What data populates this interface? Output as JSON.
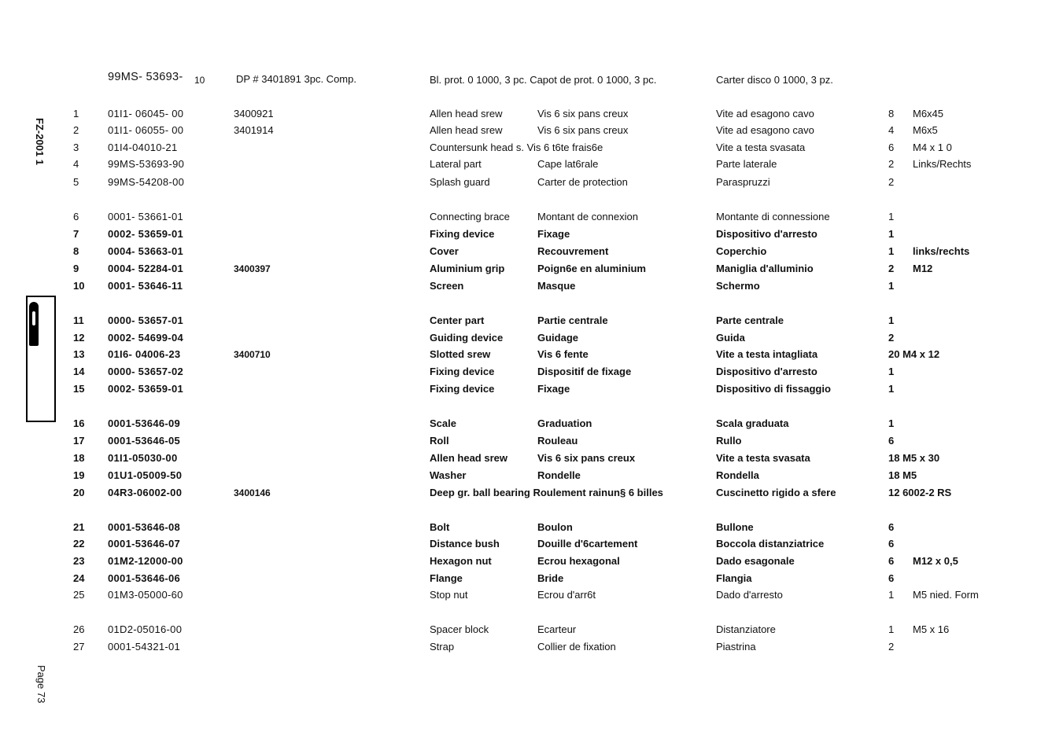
{
  "header": {
    "part": "99MS- 53693-",
    "part_suffix": "10",
    "ref": "DP # 3401891 3pc. Comp.",
    "en": "Bl. prot. 0 1000, 3 pc. Capot de prot. 0 1000, 3 pc.",
    "it": "Carter disco 0 1000, 3 pz."
  },
  "side": {
    "doc_code": "FZ-2001 1",
    "page": "Page 73"
  },
  "rows": [
    {
      "num": "1",
      "part": "01I1-   06045- 00",
      "ref": "3400921",
      "en": "Allen head srew",
      "fr": "Vis 6 six pans creux",
      "it": "Vite ad esagono cavo",
      "qty": "8",
      "size": "M6x45",
      "bold": false
    },
    {
      "num": "2",
      "part": "01I1-  06055- 00",
      "ref": "3401914",
      "en": "Allen head srew",
      "fr": "Vis 6 six pans creux",
      "it": "Vite ad esagono cavo",
      "qty": "4",
      "size": "M6x5",
      "bold": false
    },
    {
      "num": "3",
      "part": "01I4-04010-21",
      "ref": "",
      "en": "Countersunk head s. Vis 6 t6te frais6e",
      "fr": "",
      "it": "Vite a testa svasata",
      "qty": "6",
      "size": "M4 x 1 0",
      "bold": false
    },
    {
      "num": "4",
      "part": "99MS-53693-90",
      "ref": "",
      "en": "Lateral part",
      "fr": "Cape lat6rale",
      "it": "Parte laterale",
      "qty": "2",
      "size": "Links/Rechts",
      "bold": false
    },
    {
      "num": "5",
      "part": "99MS-54208-00",
      "ref": "",
      "en": "Splash guard",
      "fr": "Carter de protection",
      "it": "Paraspruzzi",
      "qty": "2",
      "size": "",
      "bold": false
    },
    {
      "num": "6",
      "part": "0001- 53661-01",
      "ref": "",
      "en": "Connecting brace",
      "fr": "Montant de connexion",
      "it": "Montante di connessione",
      "qty": "1",
      "size": "",
      "bold": false
    },
    {
      "num": "7",
      "part": "0002- 53659-01",
      "ref": "",
      "en": "Fixing device",
      "fr": "Fixage",
      "it": "Dispositivo d'arresto",
      "qty": "1",
      "size": "",
      "bold": true
    },
    {
      "num": "8",
      "part": "0004- 53663-01",
      "ref": "",
      "en": "Cover",
      "fr": "Recouvrement",
      "it": "Coperchio",
      "qty": "1",
      "size": "links/rechts",
      "bold": true
    },
    {
      "num": "9",
      "part": "0004- 52284-01",
      "ref": "3400397",
      "en": "Aluminium grip",
      "fr": "Poign6e en aluminium",
      "it": "Maniglia d'alluminio",
      "qty": "2",
      "size": "M12",
      "bold": true
    },
    {
      "num": "10",
      "part": "0001- 53646-11",
      "ref": "",
      "en": "Screen",
      "fr": "Masque",
      "it": "Schermo",
      "qty": "1",
      "size": "",
      "bold": true
    },
    {
      "num": "11",
      "part": "0000- 53657-01",
      "ref": "",
      "en": "Center part",
      "fr": "Partie centrale",
      "it": "Parte centrale",
      "qty": "1",
      "size": "",
      "bold": true
    },
    {
      "num": "12",
      "part": "0002- 54699-04",
      "ref": "",
      "en": "Guiding device",
      "fr": "Guidage",
      "it": "Guida",
      "qty": "2",
      "size": "",
      "bold": true
    },
    {
      "num": "13",
      "part": "01I6- 04006-23",
      "ref": "3400710",
      "en": "Slotted srew",
      "fr": "Vis 6 fente",
      "it": "Vite a testa intagliata",
      "qty": "20 M4 x 12",
      "size": "",
      "bold": true
    },
    {
      "num": "14",
      "part": "0000- 53657-02",
      "ref": "",
      "en": "Fixing device",
      "fr": "Dispositif de fixage",
      "it": "Dispositivo d'arresto",
      "qty": "1",
      "size": "",
      "bold": true
    },
    {
      "num": "15",
      "part": "0002- 53659-01",
      "ref": "",
      "en": "Fixing device",
      "fr": "Fixage",
      "it": "Dispositivo di fissaggio",
      "qty": "1",
      "size": "",
      "bold": true
    },
    {
      "num": "16",
      "part": "0001-53646-09",
      "ref": "",
      "en": "Scale",
      "fr": "Graduation",
      "it": "Scala graduata",
      "qty": "1",
      "size": "",
      "bold": true
    },
    {
      "num": "17",
      "part": "0001-53646-05",
      "ref": "",
      "en": "Roll",
      "fr": "Rouleau",
      "it": "Rullo",
      "qty": "6",
      "size": "",
      "bold": true
    },
    {
      "num": "18",
      "part": "01I1-05030-00",
      "ref": "",
      "en": "Allen head srew",
      "fr": "Vis 6 six pans creux",
      "it": "Vite a testa svasata",
      "qty": "18 M5 x 30",
      "size": "",
      "bold": true
    },
    {
      "num": "19",
      "part": "01U1-05009-50",
      "ref": "",
      "en": "Washer",
      "fr": "Rondelle",
      "it": "Rondella",
      "qty": "18  M5",
      "size": "",
      "bold": true
    },
    {
      "num": "20",
      "part": "04R3-06002-00",
      "ref": "3400146",
      "en": "Deep gr. ball bearing Roulement rainun§ 6 billes",
      "fr": "",
      "it": "Cuscinetto rigido a sfere",
      "qty": "12 6002-2 RS",
      "size": "",
      "bold": true
    },
    {
      "num": "21",
      "part": "0001-53646-08",
      "ref": "",
      "en": "Bolt",
      "fr": "Boulon",
      "it": "Bullone",
      "qty": "6",
      "size": "",
      "bold": true
    },
    {
      "num": "22",
      "part": "0001-53646-07",
      "ref": "",
      "en": "Distance bush",
      "fr": "Douille d'6cartement",
      "it": "Boccola distanziatrice",
      "qty": "6",
      "size": "",
      "bold": true
    },
    {
      "num": "23",
      "part": "01M2-12000-00",
      "ref": "",
      "en": "Hexagon nut",
      "fr": "Ecrou hexagonal",
      "it": "Dado esagonale",
      "qty": "6",
      "size": "M12 x 0,5",
      "bold": true
    },
    {
      "num": "24",
      "part": "0001-53646-06",
      "ref": "",
      "en": "Flange",
      "fr": "Bride",
      "it": "Flangia",
      "qty": "6",
      "size": "",
      "bold": true
    },
    {
      "num": "25",
      "part": "01M3-05000-60",
      "ref": "",
      "en": "Stop nut",
      "fr": "Ecrou d'arr6t",
      "it": "Dado d'arresto",
      "qty": "1",
      "size": "M5 nied. Form",
      "bold": false
    },
    {
      "num": "26",
      "part": "01D2-05016-00",
      "ref": "",
      "en": "Spacer block",
      "fr": "Ecarteur",
      "it": "Distanziatore",
      "qty": "1",
      "size": "M5 x 16",
      "bold": false
    },
    {
      "num": "27",
      "part": "0001-54321-01",
      "ref": "",
      "en": "Strap",
      "fr": "Collier de fixation",
      "it": "Piastrina",
      "qty": "2",
      "size": "",
      "bold": false
    }
  ]
}
